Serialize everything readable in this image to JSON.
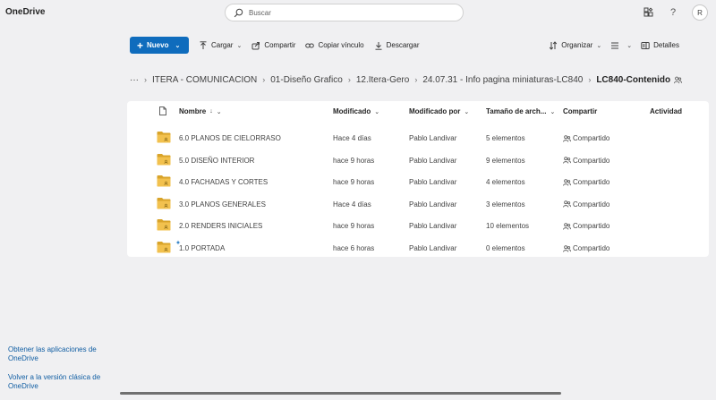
{
  "app": {
    "title": "OneDrive"
  },
  "search": {
    "placeholder": "Buscar"
  },
  "topbar": {
    "avatar_initial": "R",
    "help_label": "?"
  },
  "toolbar": {
    "new_label": "Nuevo",
    "upload_label": "Cargar",
    "share_label": "Compartir",
    "copy_link_label": "Copiar vínculo",
    "download_label": "Descargar",
    "organize_label": "Organizar",
    "details_label": "Detalles"
  },
  "breadcrumb": {
    "overflow": "···",
    "items": [
      "ITERA - COMUNICACION",
      "01-Diseño Grafico",
      "12.Itera-Gero",
      "24.07.31 - Info pagina miniaturas-LC840"
    ],
    "current": "LC840-Contenido"
  },
  "table": {
    "headers": {
      "name": "Nombre",
      "sort_arrow": "↓",
      "modified": "Modificado",
      "modified_by": "Modificado por",
      "size": "Tamaño de arch...",
      "sharing": "Compartir",
      "activity": "Actividad"
    },
    "rows": [
      {
        "name": "6.0 PLANOS DE CIELORRASO",
        "modified": "Hace 4 días",
        "modified_by": "Pablo Landivar",
        "size": "5 elementos",
        "sharing": "Compartido",
        "is_new": false
      },
      {
        "name": "5.0 DISEÑO INTERIOR",
        "modified": "hace 9 horas",
        "modified_by": "Pablo Landivar",
        "size": "9 elementos",
        "sharing": "Compartido",
        "is_new": false
      },
      {
        "name": "4.0 FACHADAS Y CORTES",
        "modified": "hace 9 horas",
        "modified_by": "Pablo Landivar",
        "size": "4 elementos",
        "sharing": "Compartido",
        "is_new": false
      },
      {
        "name": "3.0 PLANOS GENERALES",
        "modified": "Hace 4 días",
        "modified_by": "Pablo Landivar",
        "size": "3 elementos",
        "sharing": "Compartido",
        "is_new": false
      },
      {
        "name": "2.0 RENDERS INICIALES",
        "modified": "hace 9 horas",
        "modified_by": "Pablo Landivar",
        "size": "10 elementos",
        "sharing": "Compartido",
        "is_new": false
      },
      {
        "name": "1.0 PORTADA",
        "modified": "hace 6 horas",
        "modified_by": "Pablo Landivar",
        "size": "0 elementos",
        "sharing": "Compartido",
        "is_new": true
      }
    ]
  },
  "footer": {
    "get_apps": "Obtener las aplicaciones de OneDrive",
    "classic": "Volver a la versión clásica de OneDrive"
  },
  "colors": {
    "accent": "#0f6cbd",
    "folder": "#f2c14e",
    "folder_dark": "#d9a42a",
    "background": "#f0f0f2"
  }
}
